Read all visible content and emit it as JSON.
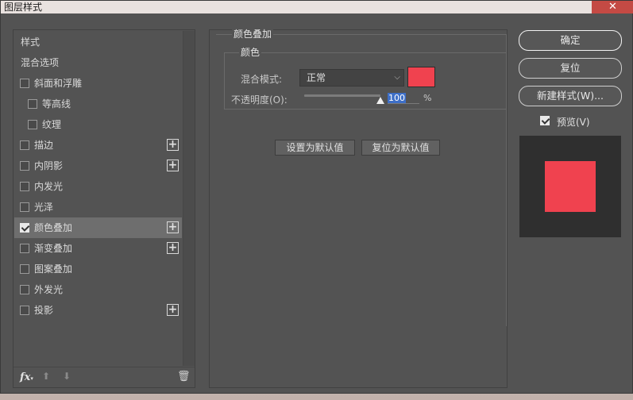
{
  "window": {
    "title": "图层样式",
    "close_glyph": "✕"
  },
  "styles_list": {
    "header": "样式",
    "blend_options": "混合选项",
    "items": [
      {
        "label": "斜面和浮雕",
        "checked": false,
        "has_add": false,
        "indent": false
      },
      {
        "label": "等高线",
        "checked": false,
        "has_add": false,
        "indent": true
      },
      {
        "label": "纹理",
        "checked": false,
        "has_add": false,
        "indent": true
      },
      {
        "label": "描边",
        "checked": false,
        "has_add": true,
        "indent": false
      },
      {
        "label": "内阴影",
        "checked": false,
        "has_add": true,
        "indent": false
      },
      {
        "label": "内发光",
        "checked": false,
        "has_add": false,
        "indent": false
      },
      {
        "label": "光泽",
        "checked": false,
        "has_add": false,
        "indent": false
      },
      {
        "label": "颜色叠加",
        "checked": true,
        "has_add": true,
        "indent": false,
        "selected": true
      },
      {
        "label": "渐变叠加",
        "checked": false,
        "has_add": true,
        "indent": false
      },
      {
        "label": "图案叠加",
        "checked": false,
        "has_add": false,
        "indent": false
      },
      {
        "label": "外发光",
        "checked": false,
        "has_add": false,
        "indent": false
      },
      {
        "label": "投影",
        "checked": false,
        "has_add": true,
        "indent": false
      }
    ],
    "add_glyph": "+",
    "toolbar": {
      "fx": "fx",
      "fx_caret": "▾",
      "up_glyph": "⬆",
      "down_glyph": "⬇",
      "trash_glyph": "🗑"
    }
  },
  "color_overlay": {
    "title": "颜色叠加",
    "color_group_title": "颜色",
    "blend_mode_label": "混合模式:",
    "blend_mode_value": "正常",
    "opacity_label": "不透明度(O):",
    "opacity_value": "100",
    "opacity_unit": "%",
    "opacity_fraction": 1.0,
    "overlay_color": "#f0424f",
    "make_default_label": "设置为默认值",
    "reset_default_label": "复位为默认值"
  },
  "actions": {
    "ok_label": "确定",
    "reset_label": "复位",
    "new_style_label": "新建样式(W)...",
    "preview_label": "预览(V)",
    "preview_checked": true
  }
}
